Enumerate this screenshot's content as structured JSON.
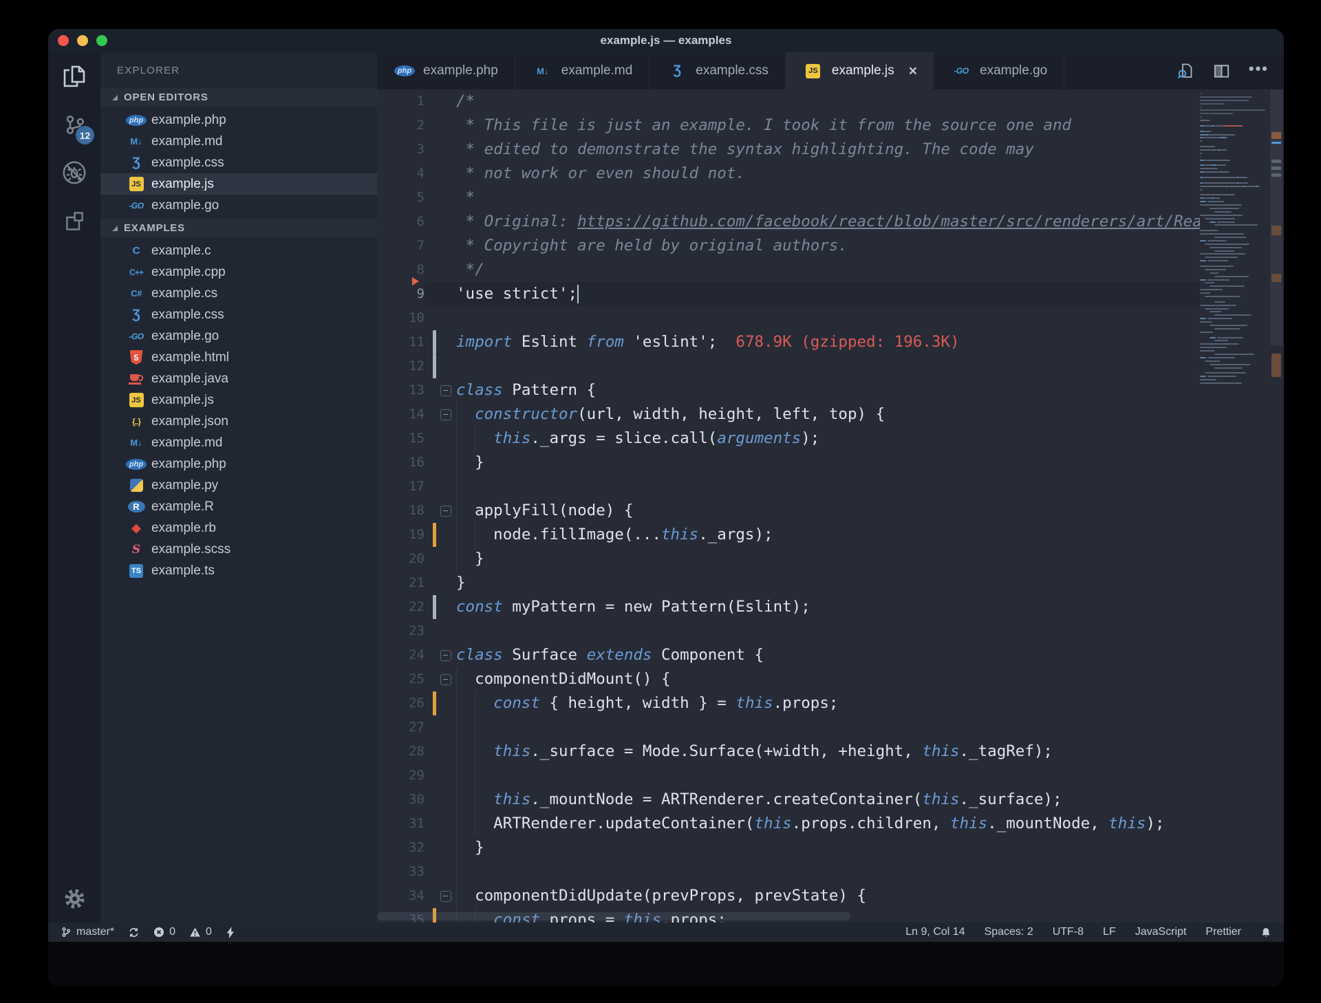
{
  "theme": {
    "bg-page": "#000000",
    "bg-window": "#0a0b0e",
    "bg-titlebar": "#1b212b",
    "bg-activitybar": "#191e28",
    "bg-sidebar": "#212732",
    "bg-sidebar-header": "#272d39",
    "bg-tabbar": "#1a1f29",
    "bg-tab-active": "#262b36",
    "bg-editor": "#262b36",
    "bg-statusbar": "#20262f",
    "bg-selected-row": "#2f3542",
    "bg-current-line": "#222733",
    "fg-default": "#dfe3ea",
    "fg-line-number": "#4b5366",
    "color-keyword": "#6c9bd3",
    "color-comment": "#7d8699",
    "color-red": "#dc5a56",
    "color-accent-blue": "#4a9add",
    "color-badge": "#3c6c9f",
    "traffic-red": "#f2564d",
    "traffic-yellow": "#f5bf4f",
    "traffic-green": "#35c84f",
    "gutter-gray": "#aab2bf",
    "gutter-orange": "#dfa03d"
  },
  "window": {
    "title": "example.js — examples",
    "traffic_lights": [
      "close",
      "minimize",
      "zoom"
    ]
  },
  "activity_bar": {
    "items": [
      {
        "icon": "files-icon",
        "name": "explorer",
        "active": true
      },
      {
        "icon": "source-control-icon",
        "name": "source-control",
        "badge": "12"
      },
      {
        "icon": "debug-disabled-icon",
        "name": "debug"
      },
      {
        "icon": "extensions-icon",
        "name": "extensions"
      }
    ],
    "bottom_items": [
      {
        "icon": "gear-icon",
        "name": "settings"
      }
    ]
  },
  "sidebar": {
    "title": "EXPLORER",
    "sections": [
      {
        "label": "OPEN EDITORS",
        "items": [
          {
            "icon": "php",
            "label": "example.php"
          },
          {
            "icon": "md",
            "label": "example.md"
          },
          {
            "icon": "css",
            "label": "example.css"
          },
          {
            "icon": "js",
            "label": "example.js",
            "selected": true
          },
          {
            "icon": "go",
            "label": "example.go"
          }
        ]
      },
      {
        "label": "EXAMPLES",
        "items": [
          {
            "icon": "c",
            "label": "example.c"
          },
          {
            "icon": "cpp",
            "label": "example.cpp"
          },
          {
            "icon": "cs",
            "label": "example.cs"
          },
          {
            "icon": "css",
            "label": "example.css"
          },
          {
            "icon": "go",
            "label": "example.go"
          },
          {
            "icon": "html",
            "label": "example.html"
          },
          {
            "icon": "java",
            "label": "example.java"
          },
          {
            "icon": "js",
            "label": "example.js"
          },
          {
            "icon": "json",
            "label": "example.json"
          },
          {
            "icon": "md",
            "label": "example.md"
          },
          {
            "icon": "php",
            "label": "example.php"
          },
          {
            "icon": "py",
            "label": "example.py"
          },
          {
            "icon": "r",
            "label": "example.R"
          },
          {
            "icon": "rb",
            "label": "example.rb"
          },
          {
            "icon": "scss",
            "label": "example.scss"
          },
          {
            "icon": "ts",
            "label": "example.ts"
          }
        ]
      }
    ]
  },
  "tabs": [
    {
      "icon": "php",
      "label": "example.php"
    },
    {
      "icon": "md",
      "label": "example.md"
    },
    {
      "icon": "css",
      "label": "example.css"
    },
    {
      "icon": "js",
      "label": "example.js",
      "active": true,
      "close": true
    },
    {
      "icon": "go",
      "label": "example.go"
    }
  ],
  "editor_actions": [
    {
      "icon": "open-preview-icon",
      "name": "open-preview"
    },
    {
      "icon": "split-editor-icon",
      "name": "split-editor"
    },
    {
      "icon": "more-actions-icon",
      "name": "more-actions"
    }
  ],
  "editor": {
    "lines": [
      {
        "n": 1,
        "t": [
          [
            "c",
            "/*"
          ]
        ]
      },
      {
        "n": 2,
        "t": [
          [
            "c",
            " * This file is just an example. I took it from the source one and"
          ]
        ]
      },
      {
        "n": 3,
        "t": [
          [
            "c",
            " * edited to demonstrate the syntax highlighting. The code may"
          ]
        ]
      },
      {
        "n": 4,
        "t": [
          [
            "c",
            " * not work or even should not."
          ]
        ]
      },
      {
        "n": 5,
        "t": [
          [
            "c",
            " *"
          ]
        ]
      },
      {
        "n": 6,
        "t": [
          [
            "c",
            " * Original: "
          ],
          [
            "cu",
            "https://github.com/facebook/react/blob/master/src/renderers/art/ReactA"
          ]
        ]
      },
      {
        "n": 7,
        "t": [
          [
            "c",
            " * Copyright are held by original authors."
          ]
        ]
      },
      {
        "n": 8,
        "t": [
          [
            "c",
            " */"
          ]
        ]
      },
      {
        "n": 9,
        "t": [
          [
            "p",
            "'use strict';"
          ]
        ],
        "cur": true,
        "col": 14,
        "mk": true
      },
      {
        "n": 10,
        "t": []
      },
      {
        "n": 11,
        "t": [
          [
            "k",
            "import"
          ],
          [
            "p",
            " Eslint "
          ],
          [
            "k",
            "from"
          ],
          [
            "p",
            " 'eslint';  "
          ],
          [
            "r",
            "678.9K (gzipped: 196.3K)"
          ]
        ],
        "bar": "gray"
      },
      {
        "n": 12,
        "t": [],
        "bar": "gray"
      },
      {
        "n": 13,
        "t": [
          [
            "k",
            "class"
          ],
          [
            "p",
            " Pattern {"
          ]
        ],
        "fold": true
      },
      {
        "n": 14,
        "t": [
          [
            "p",
            "  "
          ],
          [
            "k",
            "constructor"
          ],
          [
            "p",
            "(url, width, height, left, top) {"
          ]
        ],
        "fold": true,
        "g": [
          0
        ]
      },
      {
        "n": 15,
        "t": [
          [
            "p",
            "    "
          ],
          [
            "k",
            "this"
          ],
          [
            "p",
            "._args = slice.call("
          ],
          [
            "k",
            "arguments"
          ],
          [
            "p",
            ");"
          ]
        ],
        "g": [
          0,
          2
        ]
      },
      {
        "n": 16,
        "t": [
          [
            "p",
            "  }"
          ]
        ],
        "g": [
          0
        ]
      },
      {
        "n": 17,
        "t": [],
        "g": [
          0
        ]
      },
      {
        "n": 18,
        "t": [
          [
            "p",
            "  applyFill(node) {"
          ]
        ],
        "fold": true,
        "g": [
          0
        ]
      },
      {
        "n": 19,
        "t": [
          [
            "p",
            "    node.fillImage(..."
          ],
          [
            "k",
            "this"
          ],
          [
            "p",
            "._args);"
          ]
        ],
        "bar": "orange",
        "g": [
          0,
          2
        ]
      },
      {
        "n": 20,
        "t": [
          [
            "p",
            "  }"
          ]
        ],
        "g": [
          0
        ]
      },
      {
        "n": 21,
        "t": [
          [
            "p",
            "}"
          ]
        ]
      },
      {
        "n": 22,
        "t": [
          [
            "k",
            "const"
          ],
          [
            "p",
            " myPattern = new Pattern(Eslint);"
          ]
        ],
        "bar": "gray"
      },
      {
        "n": 23,
        "t": []
      },
      {
        "n": 24,
        "t": [
          [
            "k",
            "class"
          ],
          [
            "p",
            " Surface "
          ],
          [
            "k",
            "extends"
          ],
          [
            "p",
            " Component {"
          ]
        ],
        "fold": true
      },
      {
        "n": 25,
        "t": [
          [
            "p",
            "  componentDidMount() {"
          ]
        ],
        "fold": true,
        "g": [
          0
        ]
      },
      {
        "n": 26,
        "t": [
          [
            "p",
            "    "
          ],
          [
            "k",
            "const"
          ],
          [
            "p",
            " { height, width } = "
          ],
          [
            "k",
            "this"
          ],
          [
            "p",
            ".props;"
          ]
        ],
        "bar": "orange",
        "g": [
          0,
          2
        ]
      },
      {
        "n": 27,
        "t": [],
        "g": [
          0,
          2
        ]
      },
      {
        "n": 28,
        "t": [
          [
            "p",
            "    "
          ],
          [
            "k",
            "this"
          ],
          [
            "p",
            "._surface = Mode.Surface(+width, +height, "
          ],
          [
            "k",
            "this"
          ],
          [
            "p",
            "._tagRef);"
          ]
        ],
        "g": [
          0,
          2
        ]
      },
      {
        "n": 29,
        "t": [],
        "g": [
          0,
          2
        ]
      },
      {
        "n": 30,
        "t": [
          [
            "p",
            "    "
          ],
          [
            "k",
            "this"
          ],
          [
            "p",
            "._mountNode = ARTRenderer.createContainer("
          ],
          [
            "k",
            "this"
          ],
          [
            "p",
            "._surface);"
          ]
        ],
        "g": [
          0,
          2
        ]
      },
      {
        "n": 31,
        "t": [
          [
            "p",
            "    ARTRenderer.updateContainer("
          ],
          [
            "k",
            "this"
          ],
          [
            "p",
            ".props.children, "
          ],
          [
            "k",
            "this"
          ],
          [
            "p",
            "._mountNode, "
          ],
          [
            "k",
            "this"
          ],
          [
            "p",
            ");"
          ]
        ],
        "g": [
          0,
          2
        ]
      },
      {
        "n": 32,
        "t": [
          [
            "p",
            "  }"
          ]
        ],
        "g": [
          0
        ]
      },
      {
        "n": 33,
        "t": [],
        "g": [
          0
        ]
      },
      {
        "n": 34,
        "t": [
          [
            "p",
            "  componentDidUpdate(prevProps, prevState) {"
          ]
        ],
        "fold": true,
        "g": [
          0
        ]
      },
      {
        "n": 35,
        "t": [
          [
            "p",
            "    "
          ],
          [
            "k",
            "const"
          ],
          [
            "p",
            " props = "
          ],
          [
            "k",
            "this"
          ],
          [
            "p",
            ".props;"
          ]
        ],
        "bar": "orange",
        "g": [
          0,
          2
        ]
      }
    ]
  },
  "status_bar": {
    "left": [
      {
        "icon": "git-branch-icon",
        "label": "master*",
        "name": "git-branch"
      },
      {
        "icon": "sync-icon",
        "name": "sync"
      },
      {
        "icon": "error-icon",
        "label": "0",
        "name": "errors"
      },
      {
        "icon": "warning-icon",
        "label": "0",
        "name": "warnings"
      },
      {
        "icon": "bolt-icon",
        "name": "feedback"
      }
    ],
    "right": [
      {
        "label": "Ln 9, Col 14",
        "name": "cursor-position"
      },
      {
        "label": "Spaces: 2",
        "name": "indentation"
      },
      {
        "label": "UTF-8",
        "name": "encoding"
      },
      {
        "label": "LF",
        "name": "eol"
      },
      {
        "label": "JavaScript",
        "name": "language-mode"
      },
      {
        "label": "Prettier",
        "name": "formatter"
      },
      {
        "icon": "bell-icon",
        "name": "notifications"
      }
    ]
  }
}
